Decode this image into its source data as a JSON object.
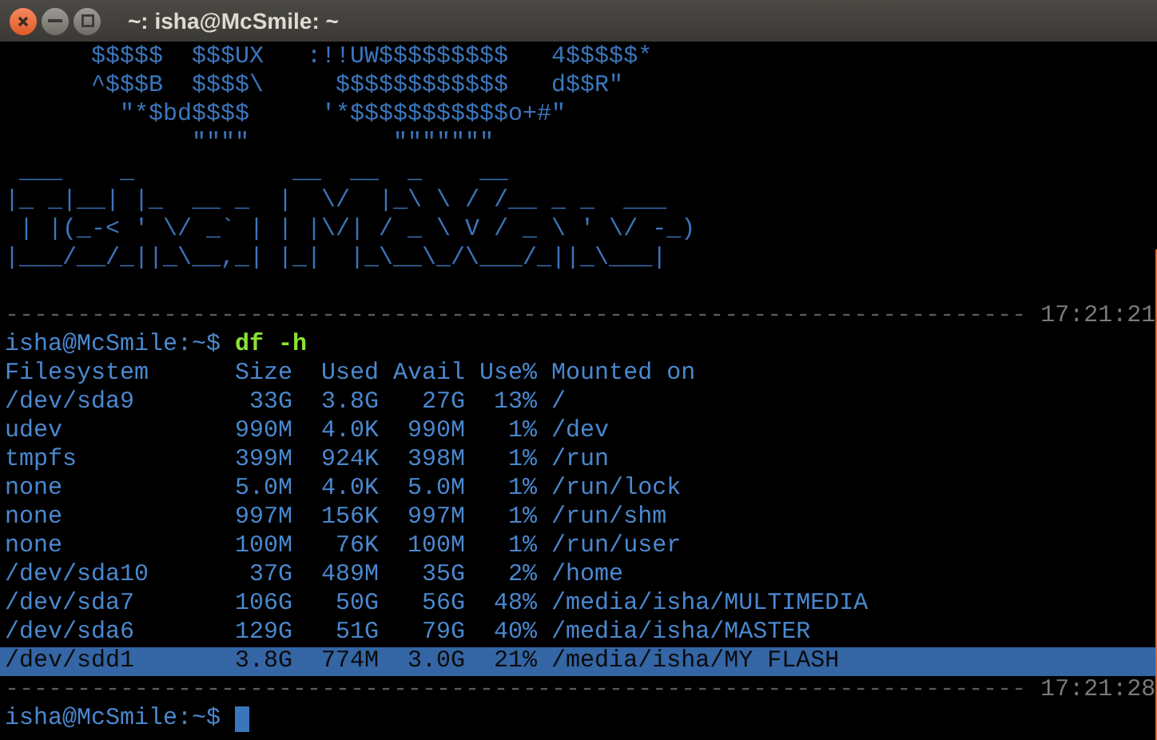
{
  "window": {
    "title": "~: isha@McSmile: ~"
  },
  "terminal": {
    "lines": [
      {
        "kind": "art",
        "text": "      $$$$$  $$$UX   :!!UW$$$$$$$$$   4$$$$$*"
      },
      {
        "kind": "art",
        "text": "      ^$$$B  $$$$\\     $$$$$$$$$$$$   d$$R\""
      },
      {
        "kind": "art",
        "text": "        \"*$bd$$$$     '*$$$$$$$$$$$o+#\""
      },
      {
        "kind": "art",
        "text": "             \"\"\"\"          \"\"\"\"\"\"\""
      },
      {
        "kind": "art",
        "text": " ___    _           __  __  _    __"
      },
      {
        "kind": "art",
        "text": "|_ _|__| |_  __ _  |  \\/  |_\\ \\ / /__ _ _  ___"
      },
      {
        "kind": "art",
        "text": " | |(_-< ' \\/ _` | | |\\/| / _ \\ V / _ \\ ' \\/ -_)"
      },
      {
        "kind": "art",
        "text": "|___/__/_||_\\__,_| |_|  |_\\__\\_/\\___/_||_\\___|"
      },
      {
        "kind": "blank"
      },
      {
        "kind": "separator",
        "text": "-----------------------------------------------------------------------",
        "time": "17:21:21"
      },
      {
        "kind": "prompt",
        "prompt": "isha@McSmile:~$",
        "command": "df -h"
      },
      {
        "kind": "output",
        "text": "Filesystem      Size  Used Avail Use% Mounted on",
        "selected": false
      },
      {
        "kind": "output",
        "text": "/dev/sda9        33G  3.8G   27G  13% /",
        "selected": false
      },
      {
        "kind": "output",
        "text": "udev            990M  4.0K  990M   1% /dev",
        "selected": false
      },
      {
        "kind": "output",
        "text": "tmpfs           399M  924K  398M   1% /run",
        "selected": false
      },
      {
        "kind": "output",
        "text": "none            5.0M  4.0K  5.0M   1% /run/lock",
        "selected": false
      },
      {
        "kind": "output",
        "text": "none            997M  156K  997M   1% /run/shm",
        "selected": false
      },
      {
        "kind": "output",
        "text": "none            100M   76K  100M   1% /run/user",
        "selected": false
      },
      {
        "kind": "output",
        "text": "/dev/sda10       37G  489M   35G   2% /home",
        "selected": false
      },
      {
        "kind": "output",
        "text": "/dev/sda7       106G   50G   56G  48% /media/isha/MULTIMEDIA",
        "selected": false
      },
      {
        "kind": "output",
        "text": "/dev/sda6       129G   51G   79G  40% /media/isha/MASTER",
        "selected": false
      },
      {
        "kind": "output",
        "text": "/dev/sdd1       3.8G  774M  3.0G  21% /media/isha/MY FLASH",
        "selected": true
      },
      {
        "kind": "separator",
        "text": "-----------------------------------------------------------------------",
        "time": "17:21:28"
      },
      {
        "kind": "prompt",
        "prompt": "isha@McSmile:~$",
        "cursor": true
      }
    ]
  }
}
